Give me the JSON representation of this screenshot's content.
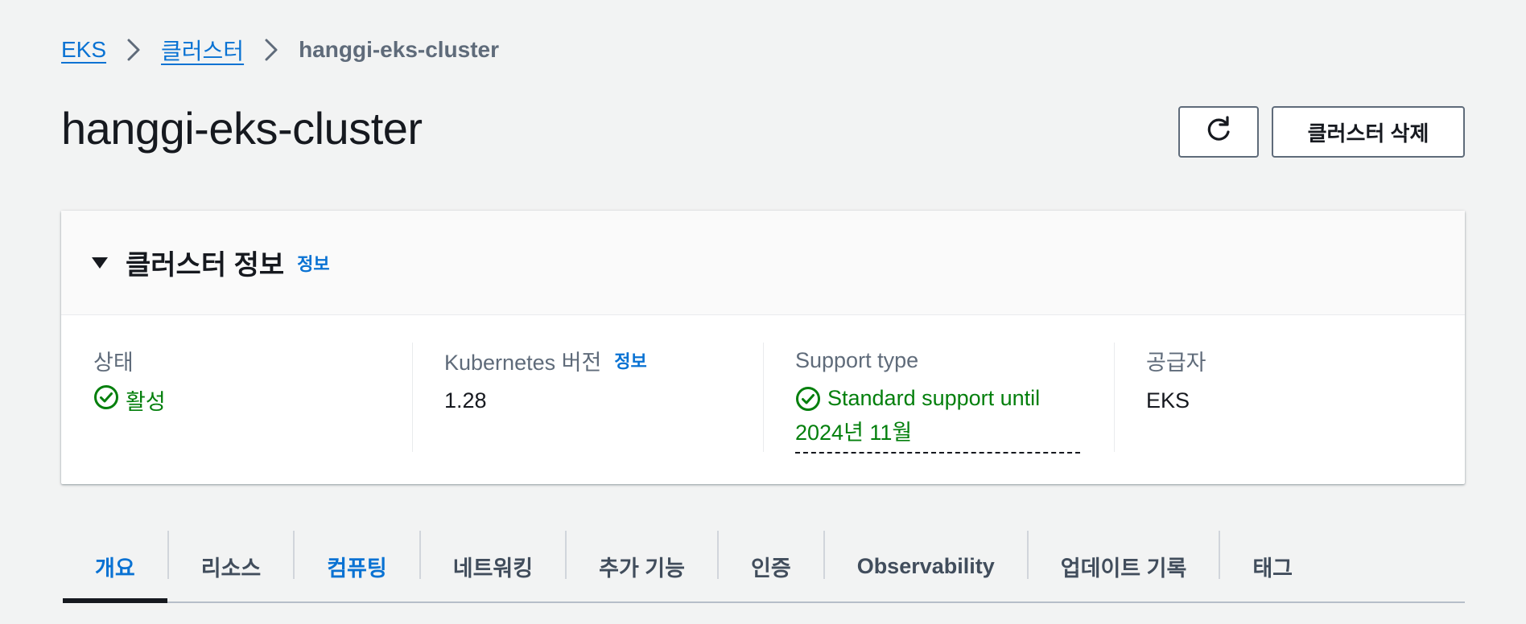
{
  "breadcrumb": {
    "items": [
      {
        "label": "EKS"
      },
      {
        "label": "클러스터"
      },
      {
        "label": "hanggi-eks-cluster"
      }
    ]
  },
  "header": {
    "title": "hanggi-eks-cluster",
    "refresh_icon": "refresh-icon",
    "delete_button": "클러스터 삭제"
  },
  "cluster_info": {
    "title": "클러스터 정보",
    "info_link": "정보",
    "fields": [
      {
        "label": "상태",
        "value": "활성",
        "status": "success"
      },
      {
        "label": "Kubernetes 버전",
        "info_link": "정보",
        "value": "1.28"
      },
      {
        "label": "Support type",
        "value_line1": "Standard support until",
        "value_line2": "2024년 11월",
        "status": "success"
      },
      {
        "label": "공급자",
        "value": "EKS"
      }
    ]
  },
  "tabs": [
    {
      "label": "개요",
      "active": true
    },
    {
      "label": "리소스"
    },
    {
      "label": "컴퓨팅",
      "highlighted": true
    },
    {
      "label": "네트워킹"
    },
    {
      "label": "추가 기능"
    },
    {
      "label": "인증"
    },
    {
      "label": "Observability"
    },
    {
      "label": "업데이트 기록"
    },
    {
      "label": "태그"
    }
  ],
  "colors": {
    "link": "#0972d3",
    "success": "#037f0c",
    "background": "#f2f3f3",
    "text": "#16191f",
    "muted": "#5f6b7a"
  }
}
